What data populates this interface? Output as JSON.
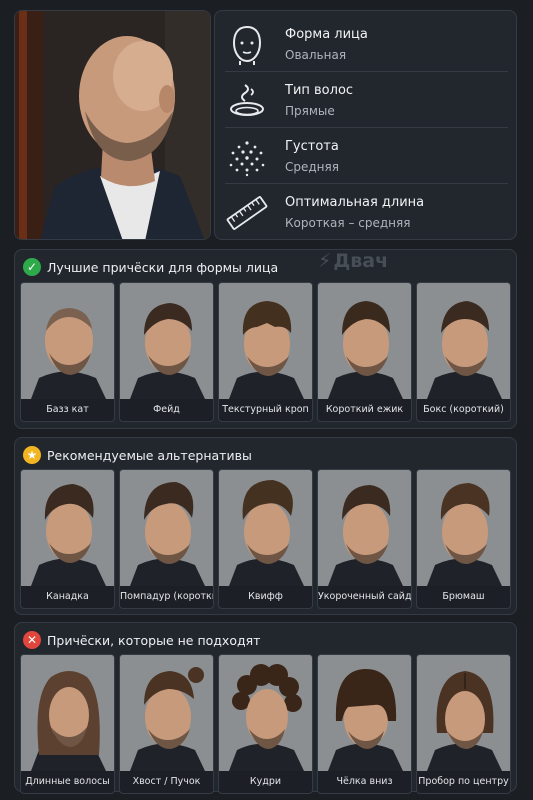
{
  "profile": {
    "items": [
      {
        "icon": "face-outline-icon",
        "title": "Форма лица",
        "value": "Овальная"
      },
      {
        "icon": "hair-wave-icon",
        "title": "Тип волос",
        "value": "Прямые"
      },
      {
        "icon": "density-dots-icon",
        "title": "Густота",
        "value": "Средняя"
      },
      {
        "icon": "ruler-icon",
        "title": "Оптимальная длина",
        "value": "Короткая – средняя"
      }
    ]
  },
  "watermark": {
    "text": "Двач"
  },
  "sections": {
    "best": {
      "badge_icon": "check-icon",
      "badge_color": "#2eaa4a",
      "title": "Лучшие причёски для формы лица",
      "items": [
        "Базз кат",
        "Фейд",
        "Текстурный кроп",
        "Короткий ежик",
        "Бокс (короткий)"
      ]
    },
    "recommended": {
      "badge_icon": "star-icon",
      "badge_color": "#f2b522",
      "title": "Рекомендуемые альтернативы",
      "items": [
        "Канадка",
        "Помпадур (короткий)",
        "Квифф",
        "Укороченный сайд парт",
        "Брюмаш"
      ]
    },
    "bad": {
      "badge_icon": "cross-icon",
      "badge_color": "#e0463c",
      "title": "Причёски, которые не подходят",
      "items": [
        "Длинные волосы",
        "Хвост / Пучок",
        "Кудри",
        "Чёлка вниз",
        "Пробор по центру"
      ]
    }
  }
}
